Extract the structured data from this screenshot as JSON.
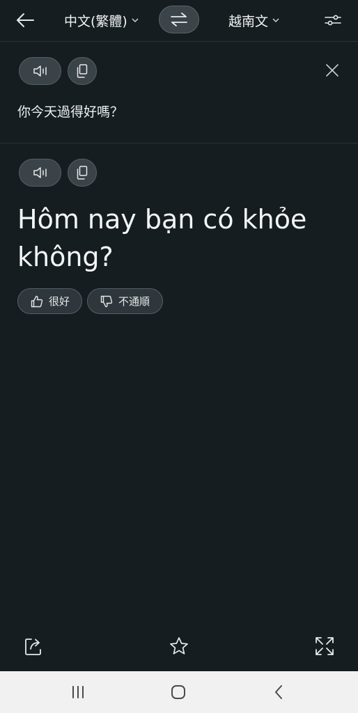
{
  "header": {
    "source_language": "中文(繁體)",
    "target_language": "越南文"
  },
  "source": {
    "text": "你今天過得好嗎？"
  },
  "result": {
    "text": "Hôm nay bạn có khỏe không?"
  },
  "feedback": {
    "good_label": "很好",
    "bad_label": "不通順"
  },
  "colors": {
    "background": "#151d20",
    "pill": "#3a4347",
    "text": "#f3f5f6",
    "navbar": "#f1f1f1"
  },
  "icons": {
    "back": "arrow-left-icon",
    "swap": "swap-arrows-icon",
    "settings": "sliders-icon",
    "speak": "speaker-icon",
    "copy": "copy-icon",
    "close": "close-icon",
    "thumbs_up": "thumbs-up-icon",
    "thumbs_down": "thumbs-down-icon",
    "share": "share-icon",
    "favorite": "star-icon",
    "expand": "expand-icon"
  }
}
